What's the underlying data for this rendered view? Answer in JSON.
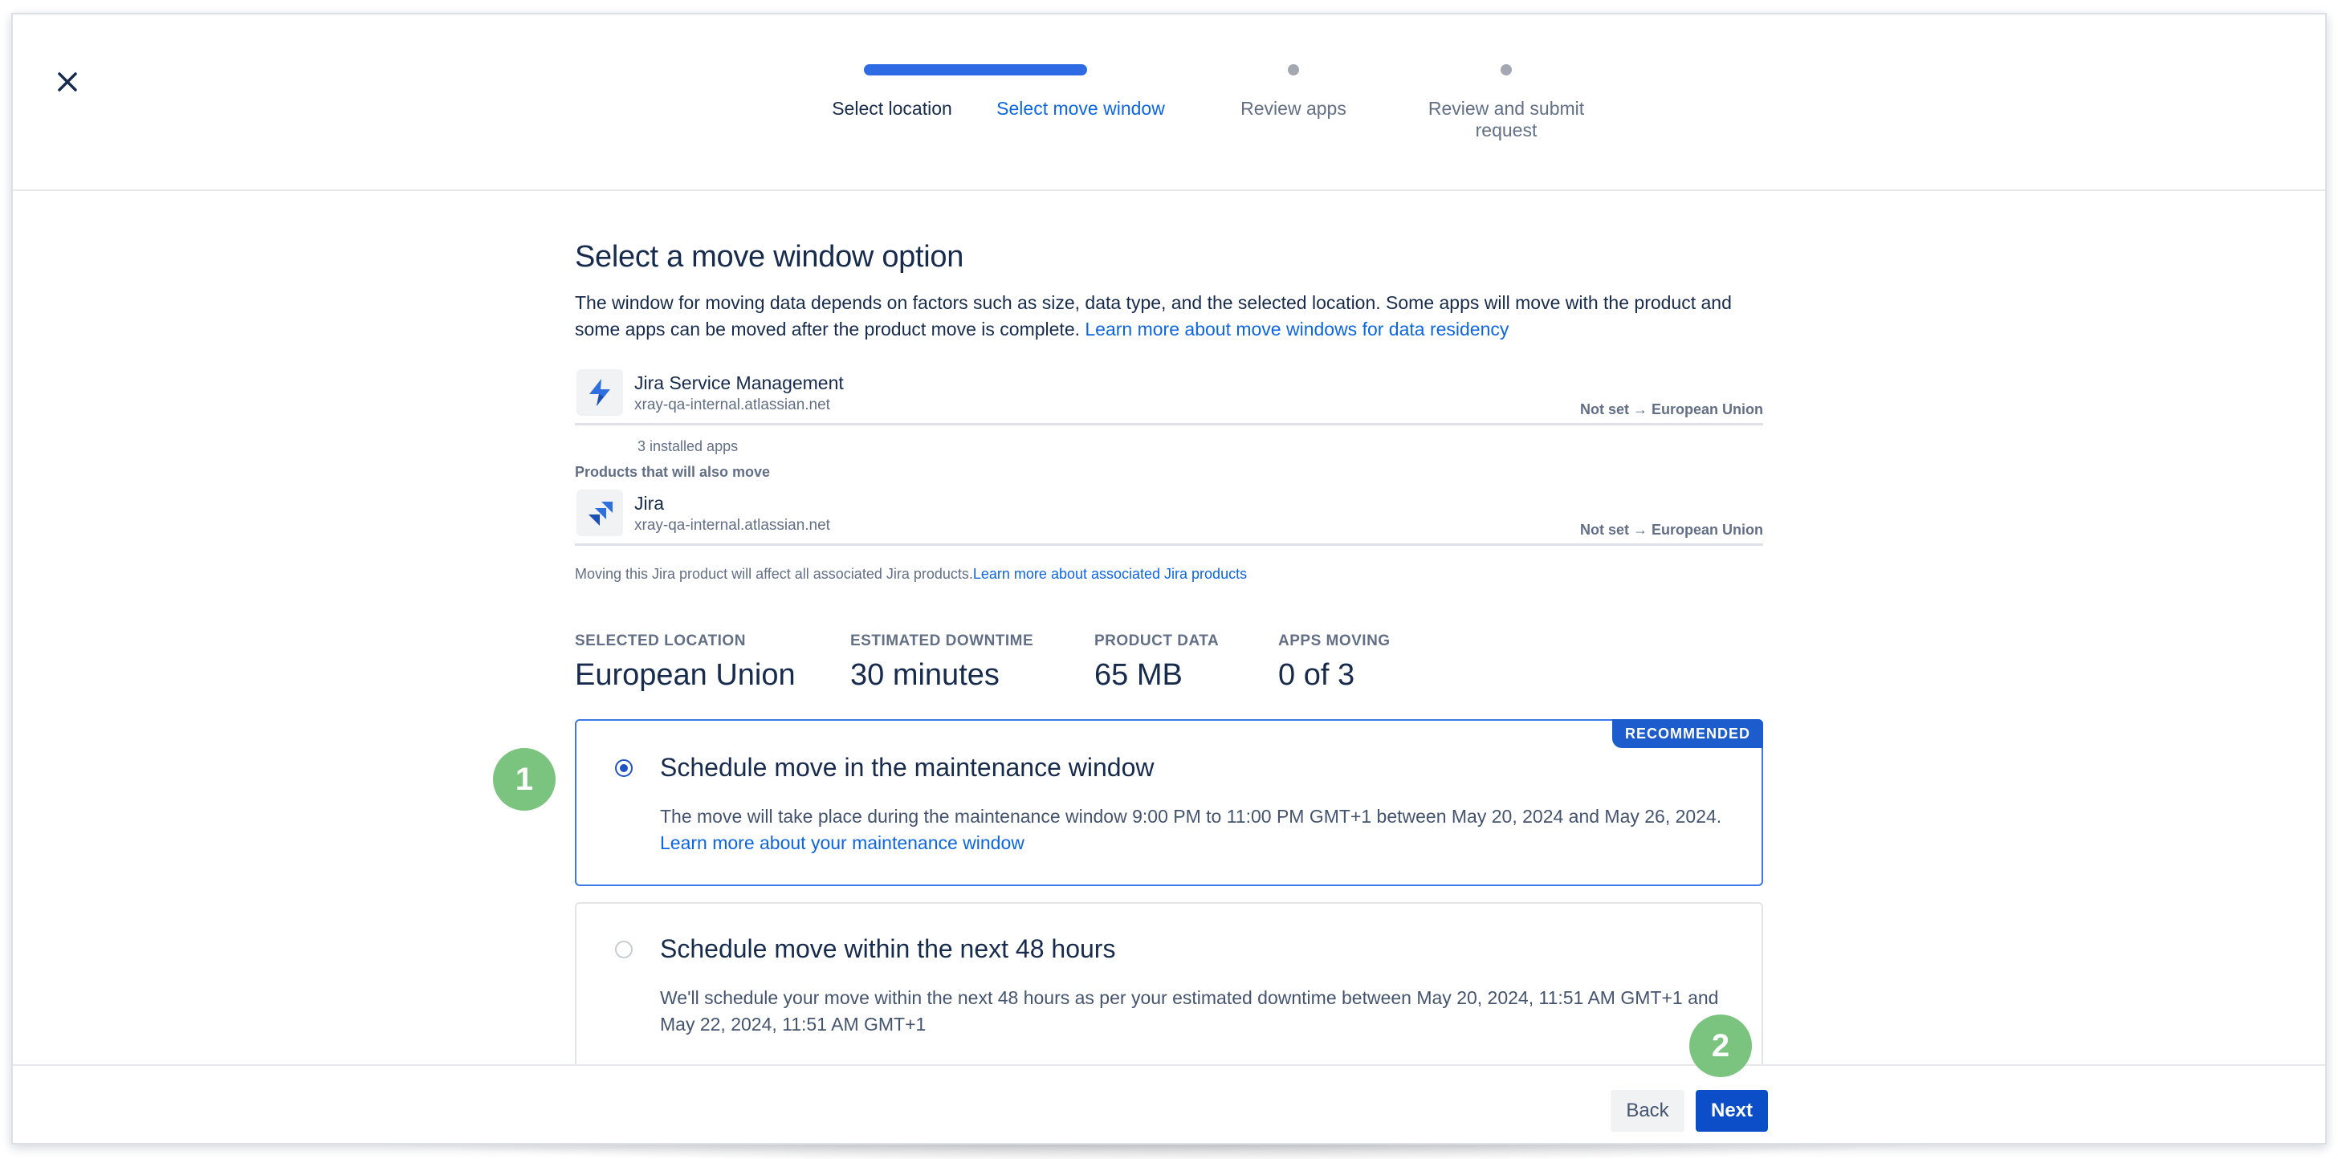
{
  "stepper": {
    "steps": [
      {
        "label": "Select location",
        "state": "completed"
      },
      {
        "label": "Select move window",
        "state": "current"
      },
      {
        "label": "Review apps",
        "state": "upcoming"
      },
      {
        "label": "Review and submit request",
        "state": "upcoming"
      }
    ]
  },
  "main": {
    "title": "Select a move window option",
    "description": "The window for moving data depends on factors such as size, data type, and the selected location. Some apps will move with the product and some apps can be moved after the product move is complete.",
    "description_link": "Learn more about move windows for data residency"
  },
  "products": {
    "primary": {
      "name": "Jira Service Management",
      "url": "xray-qa-internal.atlassian.net",
      "status": "Not set → European Union",
      "installed_apps": "3 installed apps",
      "icon": "jira-service-management-icon"
    },
    "also_move_heading": "Products that will also move",
    "secondary": {
      "name": "Jira",
      "url": "xray-qa-internal.atlassian.net",
      "status": "Not set → European Union",
      "icon": "jira-icon"
    },
    "note": "Moving this Jira product will affect all associated Jira products.",
    "note_link": "Learn more about associated Jira products"
  },
  "stats": [
    {
      "label": "SELECTED LOCATION",
      "value": "European Union"
    },
    {
      "label": "ESTIMATED DOWNTIME",
      "value": "30 minutes"
    },
    {
      "label": "PRODUCT DATA",
      "value": "65 MB"
    },
    {
      "label": "APPS MOVING",
      "value": "0 of 3"
    }
  ],
  "options": [
    {
      "title": "Schedule move in the maintenance window",
      "body": "The move will take place during the maintenance window 9:00 PM to 11:00 PM GMT+1 between May 20, 2024 and May 26, 2024.",
      "link": "Learn more about your maintenance window",
      "badge": "RECOMMENDED",
      "selected": true
    },
    {
      "title": "Schedule move within the next 48 hours",
      "body": "We'll schedule your move within the next 48 hours as per your estimated downtime between May 20, 2024, 11:51 AM GMT+1 and May 22, 2024, 11:51 AM GMT+1",
      "selected": false
    }
  ],
  "callouts": [
    "1",
    "2"
  ],
  "footer": {
    "back_label": "Back",
    "next_label": "Next"
  },
  "colors": {
    "primary": "#0c66e4",
    "button_primary": "#0c4dc8",
    "badge": "#1d5ccd",
    "callout": "#7bc47f"
  }
}
